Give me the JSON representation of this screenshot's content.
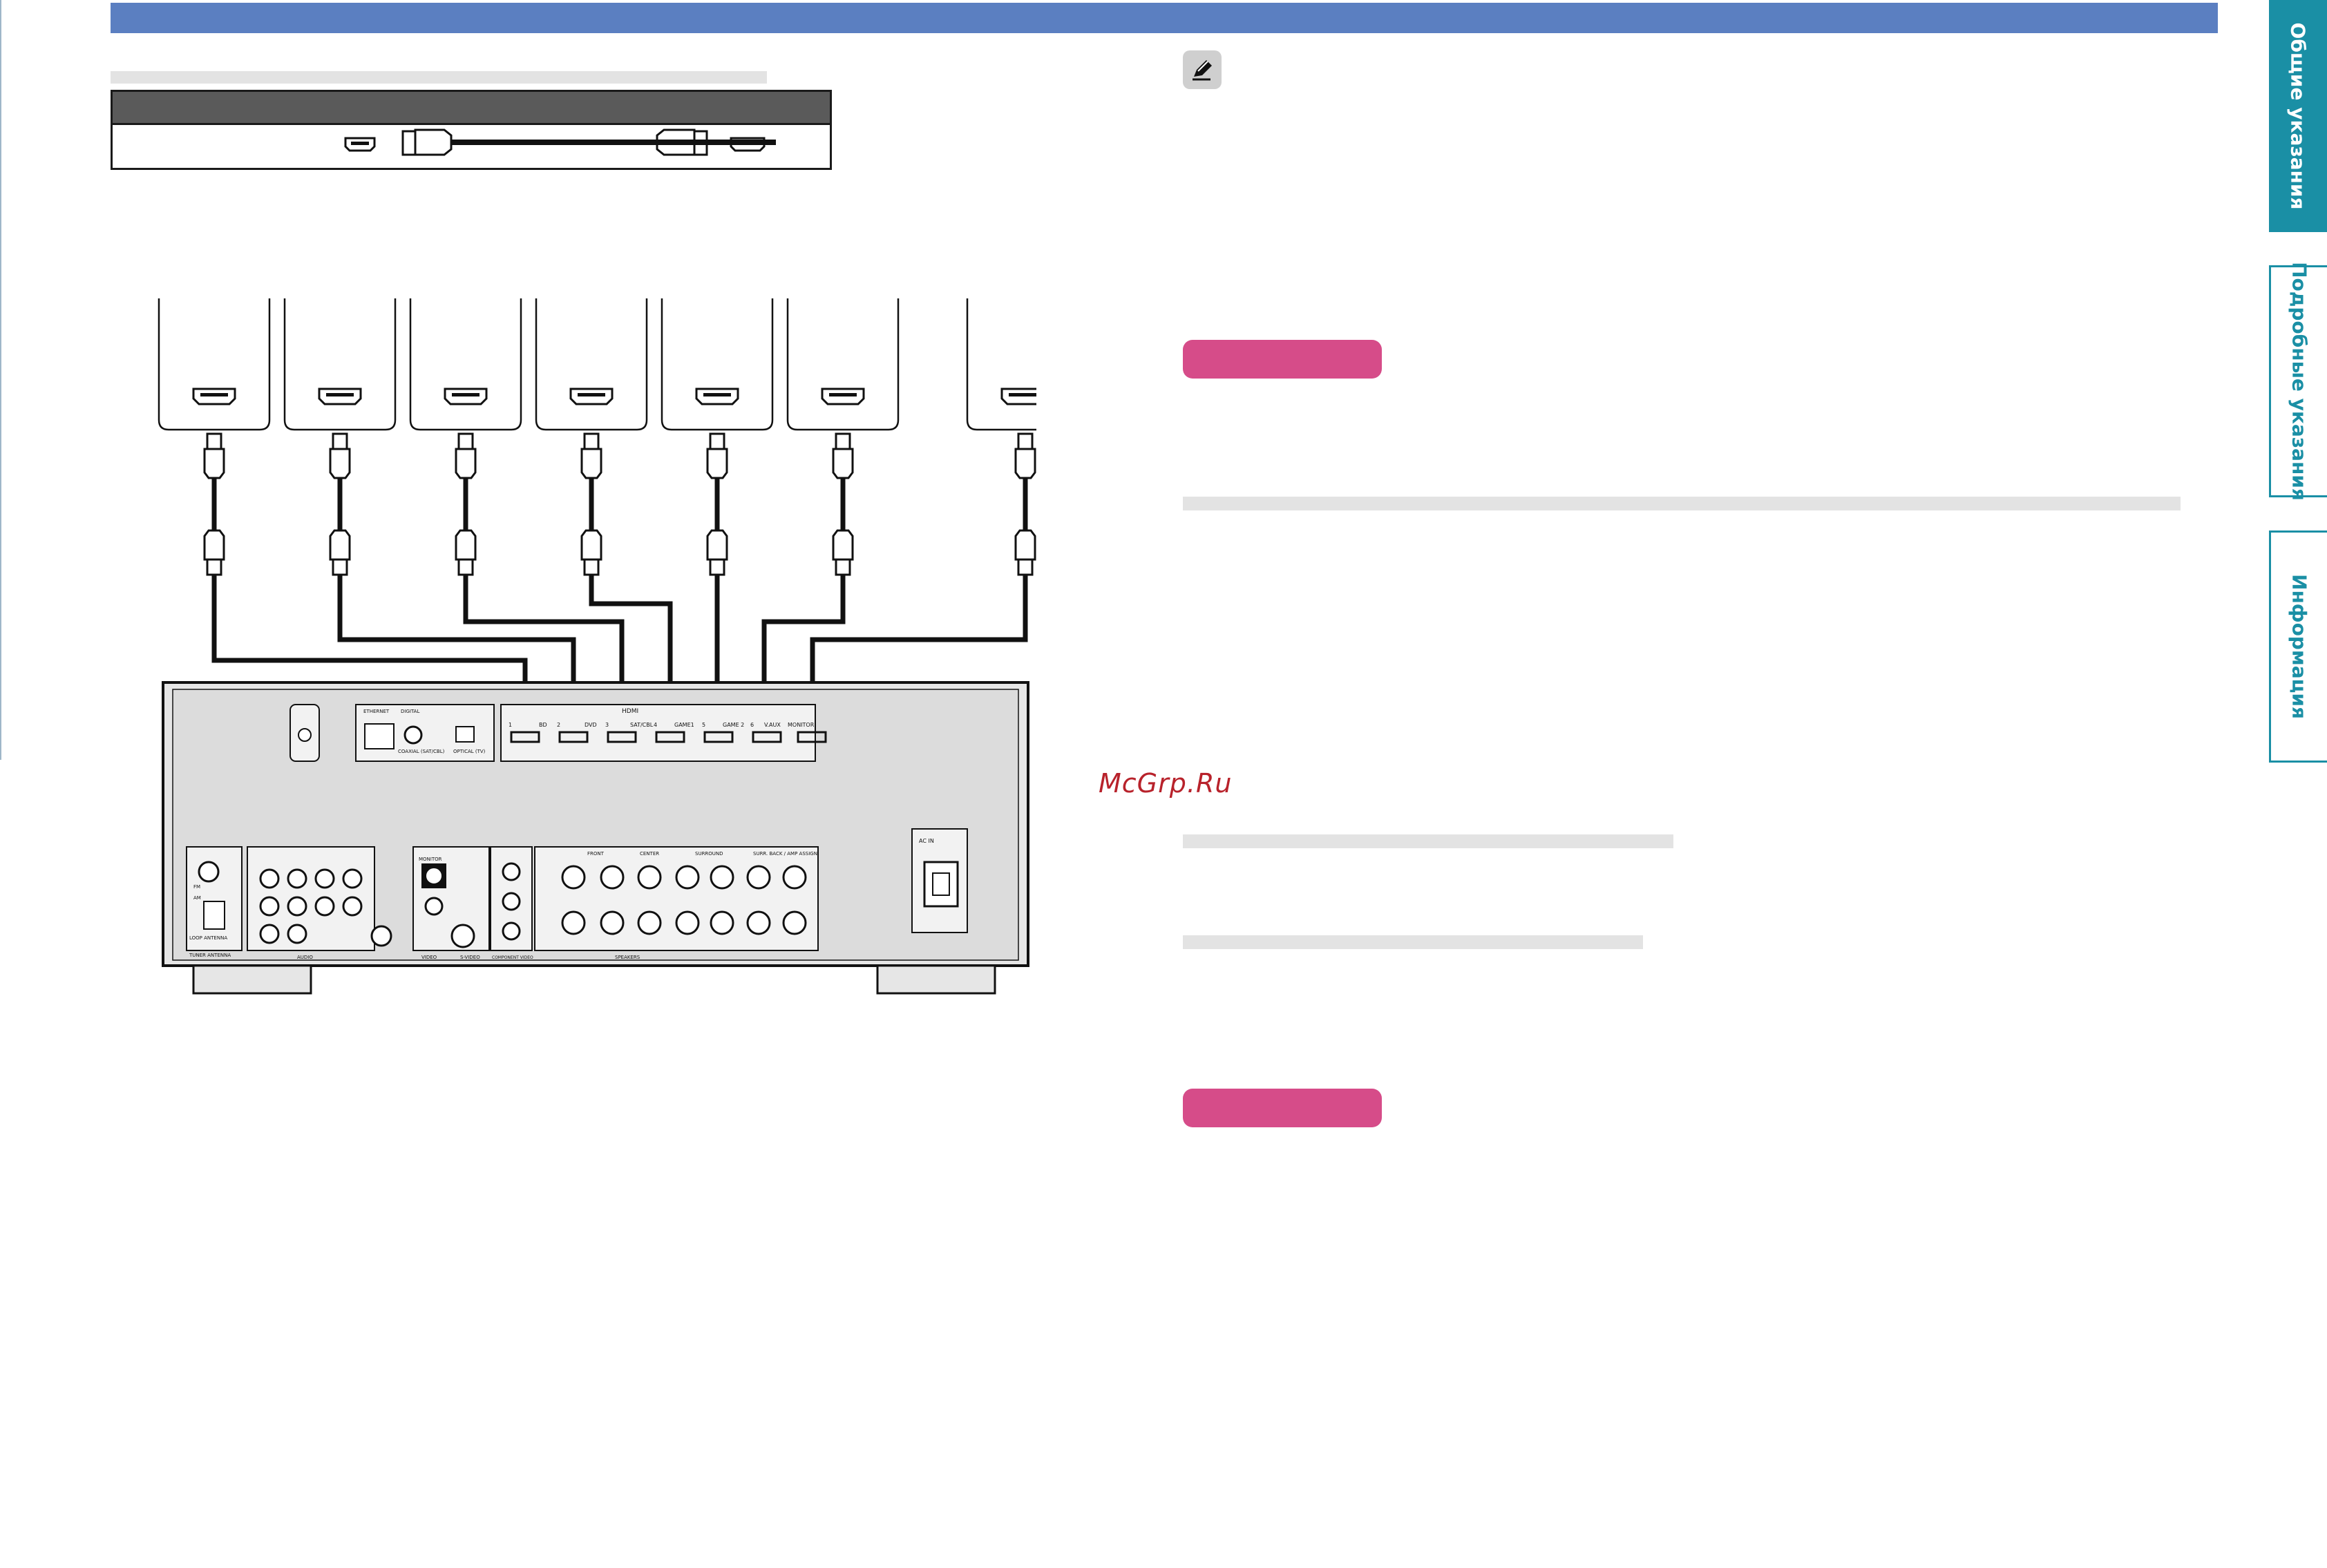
{
  "header": {
    "bar_color": "#5b7fc1"
  },
  "note": {
    "icon": "pencil-icon"
  },
  "callouts": {
    "pill_color": "#d64c89"
  },
  "watermark": {
    "text": "McGrp.Ru"
  },
  "side_tabs": [
    {
      "label": "Общие указания",
      "active": true
    },
    {
      "label": "Подробные указания",
      "active": false
    },
    {
      "label": "Информация",
      "active": false
    }
  ],
  "cable_table": {
    "connector_icons": [
      "hdmi-port-icon",
      "hdmi-cable-icon",
      "hdmi-port-icon"
    ]
  },
  "receiver": {
    "hdmi_header": "HDMI",
    "hdmi_inputs": [
      "1",
      "BD",
      "2",
      "DVD",
      "3",
      "SAT/CBL",
      "4",
      "GAME1",
      "5",
      "GAME 2",
      "6",
      "V.AUX",
      "MONITOR"
    ],
    "labels": {
      "ethernet": "ETHERNET",
      "digital": "DIGITAL",
      "coaxial": "COAXIAL (SAT/CBL)",
      "optical": "OPTICAL (TV)",
      "ac_in": "AC IN",
      "speakers": "SPEAKERS",
      "front": "FRONT",
      "center": "CENTER",
      "surround": "SURROUND",
      "surr_back": "SURR. BACK / AMP ASSIGN",
      "tuner": "TUNER ANTENNA",
      "loop": "LOOP ANTENNA",
      "audio": "AUDIO",
      "video": "VIDEO",
      "svideo": "S-VIDEO",
      "component": "COMPONENT VIDEO",
      "monitor": "MONITOR",
      "fm": "FM",
      "am": "AM"
    }
  }
}
